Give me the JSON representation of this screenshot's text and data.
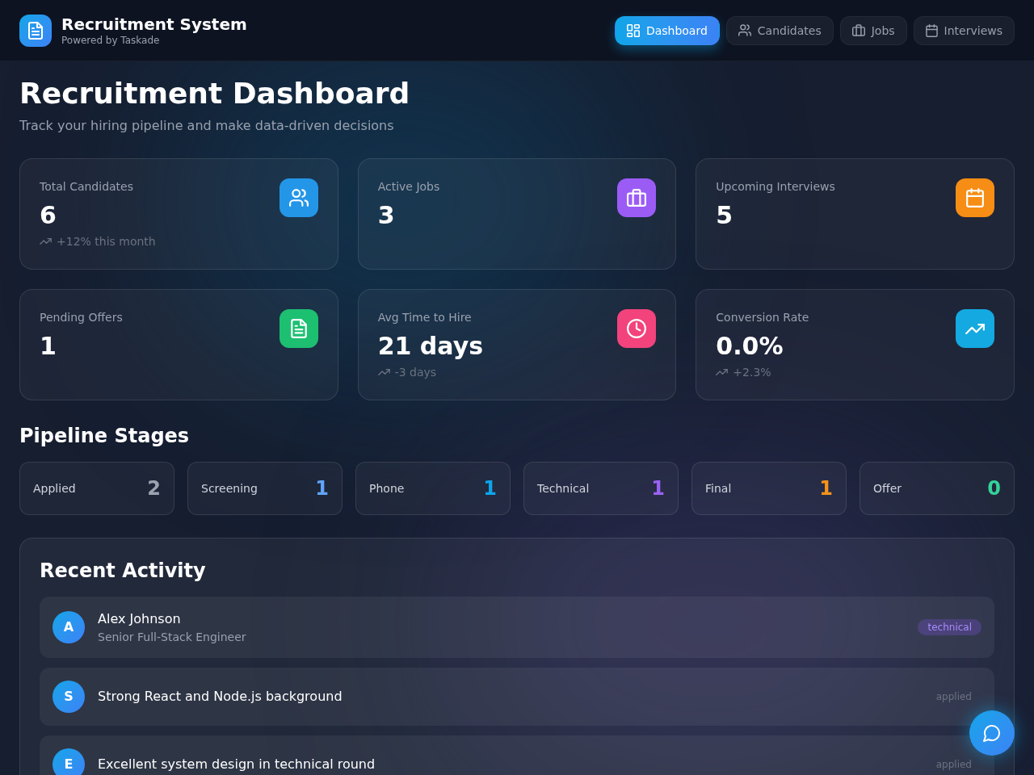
{
  "header": {
    "title": "Recruitment System",
    "subtitle": "Powered by Taskade"
  },
  "nav": [
    {
      "label": "Dashboard",
      "selected": true
    },
    {
      "label": "Candidates",
      "selected": false
    },
    {
      "label": "Jobs",
      "selected": false
    },
    {
      "label": "Interviews",
      "selected": false
    }
  ],
  "page": {
    "title": "Recruitment Dashboard",
    "subtitle": "Track your hiring pipeline and make data-driven decisions"
  },
  "stats": [
    {
      "label": "Total Candidates",
      "value": "6",
      "trend": "+12% this month",
      "color": "#2496e8"
    },
    {
      "label": "Active Jobs",
      "value": "3",
      "color": "#9b5cf6"
    },
    {
      "label": "Upcoming Interviews",
      "value": "5",
      "color": "#f68d14"
    },
    {
      "label": "Pending Offers",
      "value": "1",
      "color": "#1dbf71"
    },
    {
      "label": "Avg Time to Hire",
      "value": "21 days",
      "trend": "-3 days",
      "color": "#f2437c"
    },
    {
      "label": "Conversion Rate",
      "value": "0.0%",
      "trend": "+2.3%",
      "color": "#14a9e0"
    }
  ],
  "pipeline": {
    "title": "Pipeline Stages",
    "stages": [
      {
        "label": "Applied",
        "count": "2",
        "color": "#9ca3af"
      },
      {
        "label": "Screening",
        "count": "1",
        "color": "#60a5fa"
      },
      {
        "label": "Phone",
        "count": "1",
        "color": "#0ea5e9"
      },
      {
        "label": "Technical",
        "count": "1",
        "color": "#9a62f4"
      },
      {
        "label": "Final",
        "count": "1",
        "color": "#f7931a"
      },
      {
        "label": "Offer",
        "count": "0",
        "color": "#34d399"
      }
    ]
  },
  "activity": {
    "title": "Recent Activity",
    "items": [
      {
        "initial": "A",
        "title": "Alex Johnson",
        "subtitle": "Senior Full-Stack Engineer",
        "status": {
          "label": "technical",
          "kind": "pill"
        }
      },
      {
        "initial": "S",
        "title": "Strong React and Node.js background",
        "status": {
          "label": "applied",
          "kind": "plain"
        }
      },
      {
        "initial": "E",
        "title": "Excellent system design in technical round",
        "status": {
          "label": "applied",
          "kind": "plain"
        }
      }
    ]
  }
}
